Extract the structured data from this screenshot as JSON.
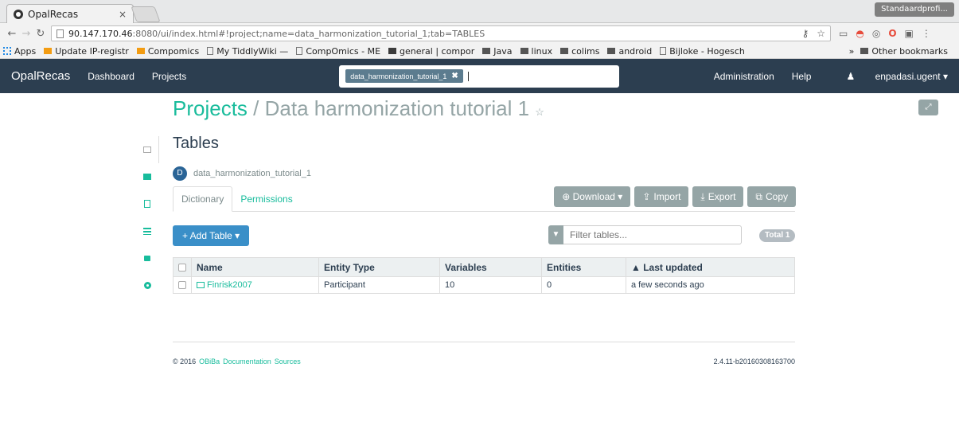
{
  "browser": {
    "tab_title": "OpalRecas",
    "tab_close": "×",
    "profile": "Standaardprofi...",
    "url_host": "90.147.170.46",
    "url_rest": ":8080/ui/index.html#!project;name=data_harmonization_tutorial_1;tab=TABLES",
    "bookmarks": [
      "Apps",
      "Update IP-registr",
      "Compomics",
      "My TiddlyWiki —",
      "CompOmics - ME",
      "general | compor",
      "Java",
      "linux",
      "colims",
      "android",
      "Bijloke - Hogesch"
    ],
    "bookmarks_more": "»",
    "other_bookmarks": "Other bookmarks"
  },
  "navbar": {
    "brand": "OpalRecas",
    "dashboard": "Dashboard",
    "projects": "Projects",
    "search_tag": "data_harmonization_tutorial_1",
    "search_tag_close": "✖",
    "administration": "Administration",
    "help": "Help",
    "user": "enpadasi.ugent ▾"
  },
  "breadcrumb": {
    "projects": "Projects",
    "separator": "/",
    "project": "Data harmonization tutorial 1",
    "star": "☆"
  },
  "page": {
    "title": "Tables",
    "datasource_badge": "D",
    "datasource": "data_harmonization_tutorial_1",
    "tabs": [
      "Dictionary",
      "Permissions"
    ],
    "buttons": {
      "download": "⊕ Download ▾",
      "import": "Import",
      "export": "Export",
      "copy": "Copy"
    },
    "add_table": "+ Add Table ▾",
    "filter_placeholder": "Filter tables...",
    "total": "Total 1"
  },
  "table": {
    "columns": [
      "Name",
      "Entity Type",
      "Variables",
      "Entities",
      "▲ Last updated"
    ],
    "rows": [
      {
        "name": "Finrisk2007",
        "entity_type": "Participant",
        "variables": "10",
        "entities": "0",
        "last_updated": "a few seconds ago"
      }
    ]
  },
  "footer": {
    "copyright": "© 2016",
    "obiba": "OBiBa",
    "documentation": "Documentation",
    "sources": "Sources",
    "version": "2.4.11-b20160308163700"
  }
}
